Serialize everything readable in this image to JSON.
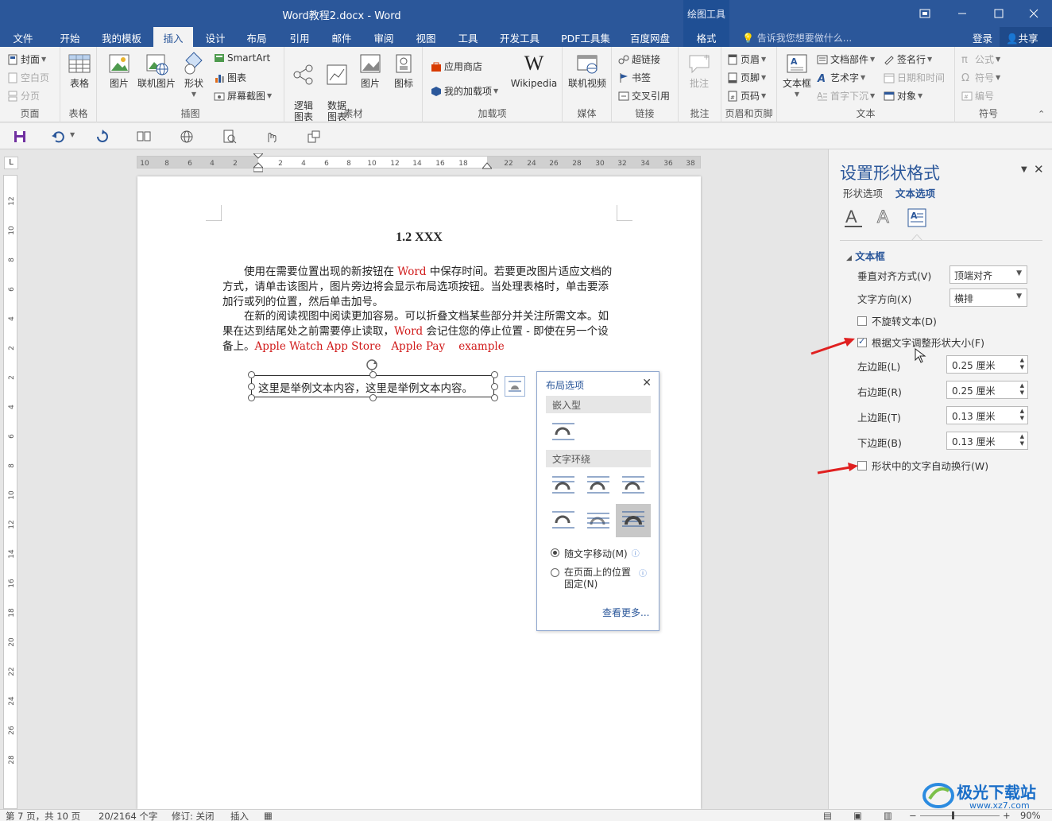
{
  "titlebar": {
    "doc_title": "Word教程2.docx - Word",
    "context_tools": "绘图工具"
  },
  "tabs": [
    {
      "label": "文件"
    },
    {
      "label": "开始"
    },
    {
      "label": "我的模板"
    },
    {
      "label": "插入"
    },
    {
      "label": "设计"
    },
    {
      "label": "布局"
    },
    {
      "label": "引用"
    },
    {
      "label": "邮件"
    },
    {
      "label": "审阅"
    },
    {
      "label": "视图"
    },
    {
      "label": "工具"
    },
    {
      "label": "开发工具"
    },
    {
      "label": "PDF工具集"
    },
    {
      "label": "百度网盘"
    },
    {
      "label": "格式"
    }
  ],
  "tell_me": "告诉我您想要做什么...",
  "login": "登录",
  "share": "共享",
  "ribbon": {
    "pages": {
      "cover": "封面",
      "blank": "空白页",
      "break": "分页",
      "label": "页面"
    },
    "tables": {
      "table": "表格",
      "label": "表格"
    },
    "illustrations": {
      "picture": "图片",
      "online_picture": "联机图片",
      "shapes": "形状",
      "smartart": "SmartArt",
      "chart": "图表",
      "screenshot": "屏幕截图",
      "label": "插图"
    },
    "materials": {
      "logic": "逻辑\n图表",
      "data": "数据\n图表",
      "picture": "图片",
      "icon": "图标",
      "label": "素材"
    },
    "addins": {
      "store": "应用商店",
      "myaddins": "我的加载项",
      "wikipedia": "Wikipedia",
      "label": "加载项"
    },
    "media": {
      "video": "联机视频",
      "label": "媒体"
    },
    "links": {
      "hyperlink": "超链接",
      "bookmark": "书签",
      "crossref": "交叉引用",
      "label": "链接"
    },
    "comments": {
      "comment": "批注",
      "label": "批注"
    },
    "header_footer": {
      "header": "页眉",
      "footer": "页脚",
      "page_number": "页码",
      "label": "页眉和页脚"
    },
    "text": {
      "textbox": "文本框",
      "quickparts": "文档部件",
      "wordart": "艺术字",
      "dropcap": "首字下沉",
      "signature": "签名行",
      "datetime": "日期和时间",
      "object": "对象",
      "label": "文本"
    },
    "symbols": {
      "equation": "公式",
      "symbol": "符号",
      "number": "编号",
      "label": "符号"
    }
  },
  "document": {
    "title": "1.2 XXX",
    "para1": {
      "a": "　　使用在需要位置出现的新按钮在 ",
      "word": "Word",
      "b": " 中保存时间。若要更改图片适应文档的方式，请单击该图片，图片旁边将会显示布局选项按钮。当处理表格时，单击要添加行或列的位置，然后单击加号。"
    },
    "para2": {
      "a": "　　在新的阅读视图中阅读更加容易。可以折叠文档某些部分并关注所需文本。如果在达到结尾处之前需要停止读取，",
      "word": "Word",
      "b": " 会记住您的停止位置 - 即使在另一个设备上。",
      "apple_watch": "Apple Watch",
      "app_store": "App Store",
      "apple_pay": "Apple Pay",
      "example": "example"
    },
    "textbox": "这里是举例文本内容，这里是举例文本内容。"
  },
  "layout_popup": {
    "title": "布局选项",
    "inline": "嵌入型",
    "wrap": "文字环绕",
    "move_with_text": "随文字移动(M)",
    "fix_position": "在页面上的位置\n固定(N)",
    "see_more": "查看更多..."
  },
  "pane": {
    "title": "设置形状格式",
    "tab_shape": "形状选项",
    "tab_text": "文本选项",
    "section": "文本框",
    "valign_label": "垂直对齐方式(V)",
    "valign_value": "顶端对齐",
    "direction_label": "文字方向(X)",
    "direction_value": "横排",
    "no_rotate": "不旋转文本(D)",
    "no_rotate_checked": false,
    "autofit": "根据文字调整形状大小(F)",
    "autofit_checked": true,
    "left_margin_label": "左边距(L)",
    "left_margin": "0.25 厘米",
    "right_margin_label": "右边距(R)",
    "right_margin": "0.25 厘米",
    "top_margin_label": "上边距(T)",
    "top_margin": "0.13 厘米",
    "bottom_margin_label": "下边距(B)",
    "bottom_margin": "0.13 厘米",
    "wrap_text": "形状中的文字自动换行(W)",
    "wrap_text_checked": false
  },
  "ruler": {
    "h_ticks": [
      "10",
      "8",
      "6",
      "4",
      "2",
      "2",
      "4",
      "6",
      "8",
      "10",
      "12",
      "14",
      "16",
      "18",
      "22",
      "24",
      "26",
      "28",
      "30",
      "32",
      "34",
      "36",
      "38"
    ],
    "v_ticks": [
      "12",
      "10",
      "8",
      "6",
      "4",
      "2",
      "2",
      "4",
      "6",
      "8",
      "10",
      "12",
      "14",
      "16",
      "18",
      "20",
      "22",
      "24",
      "26",
      "28"
    ]
  },
  "status": {
    "page": "第 7 页，共 10 页",
    "words": "20/2164 个字",
    "revise": "修订: 关闭",
    "mode": "插入",
    "zoom": "90%"
  },
  "watermark": {
    "text": "极光下载站",
    "url": "www.xz7.com"
  },
  "colors": {
    "brand": "#2b579a",
    "accent_red": "#d01818"
  }
}
